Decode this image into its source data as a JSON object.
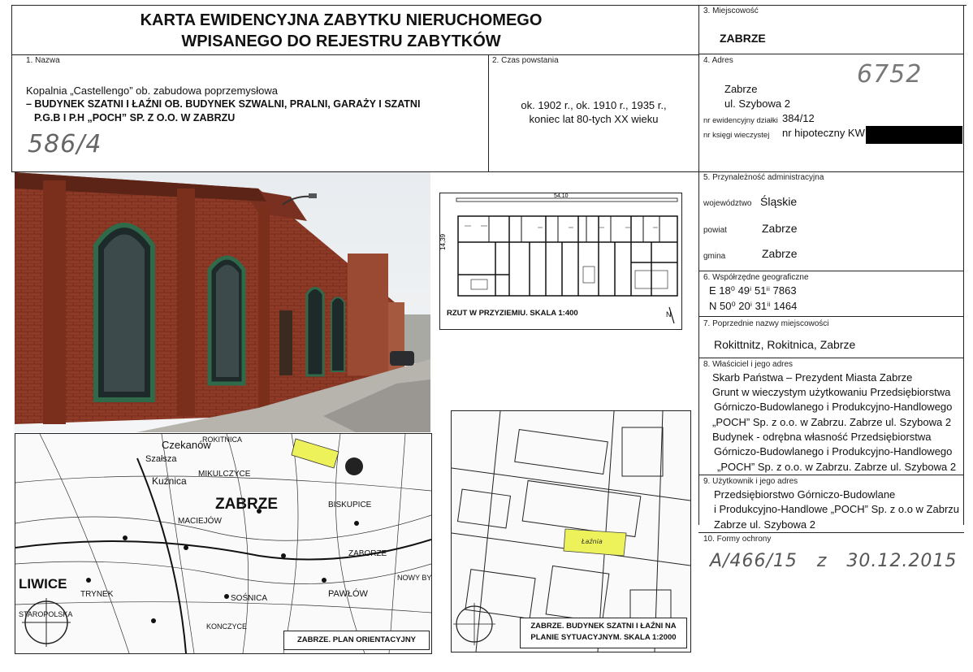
{
  "header": {
    "title_line1": "KARTA EWIDENCYJNA ZABYTKU NIERUCHOMEGO",
    "title_line2": "WPISANEGO DO REJESTRU ZABYTKÓW"
  },
  "sec1": {
    "label": "1. Nazwa",
    "line1": "Kopalnia „Castellengo” ob. zabudowa poprzemysłowa",
    "line2": "– BUDYNEK SZATNI I ŁAŹNI OB. BUDYNEK SZWALNI, PRALNI, GARAŻY I SZATNI",
    "line3": "P.G.B I P.H „POCH” SP. Z O.O.  W  ZABRZU",
    "handwritten": "586/4"
  },
  "sec2": {
    "label": "2. Czas powstania",
    "line1": "ok. 1902 r., ok. 1910 r., 1935 r.,",
    "line2": "koniec lat 80-tych XX wieku"
  },
  "sec3": {
    "label": "3. Miejscowość",
    "value": "ZABRZE"
  },
  "sec4": {
    "label": "4. Adres",
    "city": "Zabrze",
    "street": "ul. Szybowa 2",
    "plot_label": "nr ewidencyjny działki",
    "plot_value": "384/12",
    "kw_label": "nr księgi wieczystej",
    "kw_value": "nr hipoteczny KW",
    "handwritten": "6752"
  },
  "sec5": {
    "label": "5. Przynależność administracyjna",
    "woj_label": "województwo",
    "woj_value": "Śląskie",
    "powiat_label": "powiat",
    "powiat_value": "Zabrze",
    "gmina_label": "gmina",
    "gmina_value": "Zabrze"
  },
  "sec6": {
    "label": "6. Współrzędne geograficzne",
    "e": "E 18⁰ 49ⁱ 51ⁱⁱ 7863",
    "n": "N 50⁰ 20ⁱ 31ⁱⁱ 1464"
  },
  "sec7": {
    "label": "7. Poprzednie nazwy miejscowości",
    "value": "Rokittnitz, Rokitnica, Zabrze"
  },
  "sec8": {
    "label": "8. Właściciel i jego adres",
    "lines": [
      "Skarb Państwa – Prezydent Miasta Zabrze",
      "Grunt w wieczystym użytkowaniu Przedsiębiorstwa",
      "Górniczo-Budowlanego i Produkcyjno-Handlowego",
      "„POCH” Sp. z o.o. w Zabrzu. Zabrze ul. Szybowa 2",
      "Budynek - odrębna własność Przedsiębiorstwa",
      "Górniczo-Budowlanego i Produkcyjno-Handlowego",
      "„POCH” Sp. z o.o. w Zabrzu. Zabrze ul. Szybowa 2"
    ]
  },
  "sec9": {
    "label": "9. Użytkownik i jego adres",
    "lines": [
      "Przedsiębiorstwo Górniczo-Budowlane",
      "i Produkcyjno-Handlowe „POCH” Sp. z o.o w Zabrzu",
      "Zabrze ul. Szybowa 2"
    ]
  },
  "sec10": {
    "label": "10. Formy ochrony",
    "handwritten": "A/466/15   z   30.12.2015"
  },
  "plan": {
    "caption": "RZUT W PRZYZIEMIU. SKALA 1:400",
    "dimension": "54,10",
    "side_dimension": "14,39"
  },
  "map": {
    "caption": "ZABRZE. PLAN ORIENTACYJNY",
    "places": [
      "Czekanów",
      "Szałsza",
      "Kuźnica",
      "ZABRZE",
      "LIWICE",
      "MIKULCZYCE",
      "ROKITNICA",
      "MACIEJÓW",
      "SOŚNICA",
      "PAWŁÓW",
      "BISKUPICE",
      "ZABORZE",
      "KONCZYCE",
      "TRYNEK",
      "NOWY BYTOM",
      "STAROPOLSKA"
    ]
  },
  "situation": {
    "caption_line1": "ZABRZE. BUDYNEK SZATNI I ŁAŹNI NA",
    "caption_line2": "PLANIE SYTUACYJNYM.   SKALA 1:2000",
    "building_label": "Łaźnia"
  }
}
